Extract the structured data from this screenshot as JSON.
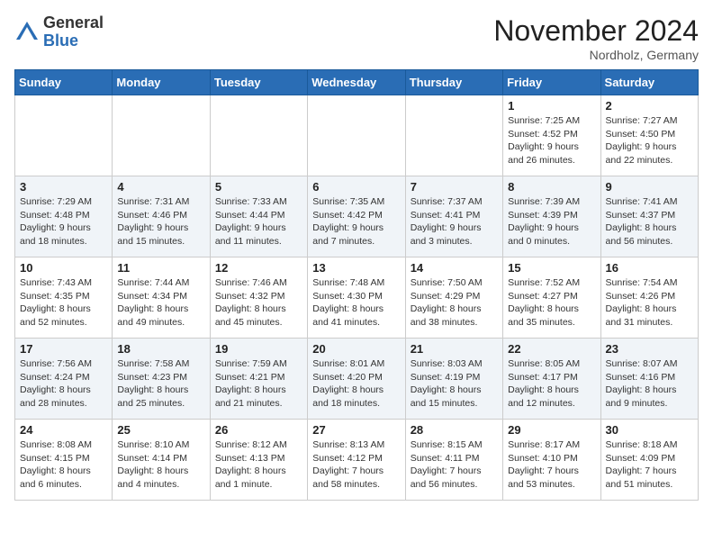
{
  "header": {
    "logo_general": "General",
    "logo_blue": "Blue",
    "month_title": "November 2024",
    "location": "Nordholz, Germany"
  },
  "days_of_week": [
    "Sunday",
    "Monday",
    "Tuesday",
    "Wednesday",
    "Thursday",
    "Friday",
    "Saturday"
  ],
  "weeks": [
    [
      {
        "day": "",
        "sunrise": "",
        "sunset": "",
        "daylight": ""
      },
      {
        "day": "",
        "sunrise": "",
        "sunset": "",
        "daylight": ""
      },
      {
        "day": "",
        "sunrise": "",
        "sunset": "",
        "daylight": ""
      },
      {
        "day": "",
        "sunrise": "",
        "sunset": "",
        "daylight": ""
      },
      {
        "day": "",
        "sunrise": "",
        "sunset": "",
        "daylight": ""
      },
      {
        "day": "1",
        "sunrise": "Sunrise: 7:25 AM",
        "sunset": "Sunset: 4:52 PM",
        "daylight": "Daylight: 9 hours and 26 minutes."
      },
      {
        "day": "2",
        "sunrise": "Sunrise: 7:27 AM",
        "sunset": "Sunset: 4:50 PM",
        "daylight": "Daylight: 9 hours and 22 minutes."
      }
    ],
    [
      {
        "day": "3",
        "sunrise": "Sunrise: 7:29 AM",
        "sunset": "Sunset: 4:48 PM",
        "daylight": "Daylight: 9 hours and 18 minutes."
      },
      {
        "day": "4",
        "sunrise": "Sunrise: 7:31 AM",
        "sunset": "Sunset: 4:46 PM",
        "daylight": "Daylight: 9 hours and 15 minutes."
      },
      {
        "day": "5",
        "sunrise": "Sunrise: 7:33 AM",
        "sunset": "Sunset: 4:44 PM",
        "daylight": "Daylight: 9 hours and 11 minutes."
      },
      {
        "day": "6",
        "sunrise": "Sunrise: 7:35 AM",
        "sunset": "Sunset: 4:42 PM",
        "daylight": "Daylight: 9 hours and 7 minutes."
      },
      {
        "day": "7",
        "sunrise": "Sunrise: 7:37 AM",
        "sunset": "Sunset: 4:41 PM",
        "daylight": "Daylight: 9 hours and 3 minutes."
      },
      {
        "day": "8",
        "sunrise": "Sunrise: 7:39 AM",
        "sunset": "Sunset: 4:39 PM",
        "daylight": "Daylight: 9 hours and 0 minutes."
      },
      {
        "day": "9",
        "sunrise": "Sunrise: 7:41 AM",
        "sunset": "Sunset: 4:37 PM",
        "daylight": "Daylight: 8 hours and 56 minutes."
      }
    ],
    [
      {
        "day": "10",
        "sunrise": "Sunrise: 7:43 AM",
        "sunset": "Sunset: 4:35 PM",
        "daylight": "Daylight: 8 hours and 52 minutes."
      },
      {
        "day": "11",
        "sunrise": "Sunrise: 7:44 AM",
        "sunset": "Sunset: 4:34 PM",
        "daylight": "Daylight: 8 hours and 49 minutes."
      },
      {
        "day": "12",
        "sunrise": "Sunrise: 7:46 AM",
        "sunset": "Sunset: 4:32 PM",
        "daylight": "Daylight: 8 hours and 45 minutes."
      },
      {
        "day": "13",
        "sunrise": "Sunrise: 7:48 AM",
        "sunset": "Sunset: 4:30 PM",
        "daylight": "Daylight: 8 hours and 41 minutes."
      },
      {
        "day": "14",
        "sunrise": "Sunrise: 7:50 AM",
        "sunset": "Sunset: 4:29 PM",
        "daylight": "Daylight: 8 hours and 38 minutes."
      },
      {
        "day": "15",
        "sunrise": "Sunrise: 7:52 AM",
        "sunset": "Sunset: 4:27 PM",
        "daylight": "Daylight: 8 hours and 35 minutes."
      },
      {
        "day": "16",
        "sunrise": "Sunrise: 7:54 AM",
        "sunset": "Sunset: 4:26 PM",
        "daylight": "Daylight: 8 hours and 31 minutes."
      }
    ],
    [
      {
        "day": "17",
        "sunrise": "Sunrise: 7:56 AM",
        "sunset": "Sunset: 4:24 PM",
        "daylight": "Daylight: 8 hours and 28 minutes."
      },
      {
        "day": "18",
        "sunrise": "Sunrise: 7:58 AM",
        "sunset": "Sunset: 4:23 PM",
        "daylight": "Daylight: 8 hours and 25 minutes."
      },
      {
        "day": "19",
        "sunrise": "Sunrise: 7:59 AM",
        "sunset": "Sunset: 4:21 PM",
        "daylight": "Daylight: 8 hours and 21 minutes."
      },
      {
        "day": "20",
        "sunrise": "Sunrise: 8:01 AM",
        "sunset": "Sunset: 4:20 PM",
        "daylight": "Daylight: 8 hours and 18 minutes."
      },
      {
        "day": "21",
        "sunrise": "Sunrise: 8:03 AM",
        "sunset": "Sunset: 4:19 PM",
        "daylight": "Daylight: 8 hours and 15 minutes."
      },
      {
        "day": "22",
        "sunrise": "Sunrise: 8:05 AM",
        "sunset": "Sunset: 4:17 PM",
        "daylight": "Daylight: 8 hours and 12 minutes."
      },
      {
        "day": "23",
        "sunrise": "Sunrise: 8:07 AM",
        "sunset": "Sunset: 4:16 PM",
        "daylight": "Daylight: 8 hours and 9 minutes."
      }
    ],
    [
      {
        "day": "24",
        "sunrise": "Sunrise: 8:08 AM",
        "sunset": "Sunset: 4:15 PM",
        "daylight": "Daylight: 8 hours and 6 minutes."
      },
      {
        "day": "25",
        "sunrise": "Sunrise: 8:10 AM",
        "sunset": "Sunset: 4:14 PM",
        "daylight": "Daylight: 8 hours and 4 minutes."
      },
      {
        "day": "26",
        "sunrise": "Sunrise: 8:12 AM",
        "sunset": "Sunset: 4:13 PM",
        "daylight": "Daylight: 8 hours and 1 minute."
      },
      {
        "day": "27",
        "sunrise": "Sunrise: 8:13 AM",
        "sunset": "Sunset: 4:12 PM",
        "daylight": "Daylight: 7 hours and 58 minutes."
      },
      {
        "day": "28",
        "sunrise": "Sunrise: 8:15 AM",
        "sunset": "Sunset: 4:11 PM",
        "daylight": "Daylight: 7 hours and 56 minutes."
      },
      {
        "day": "29",
        "sunrise": "Sunrise: 8:17 AM",
        "sunset": "Sunset: 4:10 PM",
        "daylight": "Daylight: 7 hours and 53 minutes."
      },
      {
        "day": "30",
        "sunrise": "Sunrise: 8:18 AM",
        "sunset": "Sunset: 4:09 PM",
        "daylight": "Daylight: 7 hours and 51 minutes."
      }
    ]
  ]
}
